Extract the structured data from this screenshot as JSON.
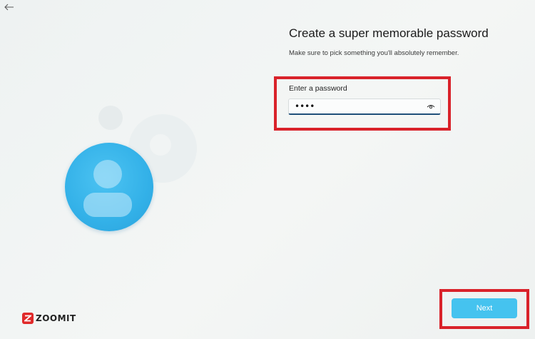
{
  "nav": {
    "back_icon": "arrow-left-icon"
  },
  "page": {
    "title": "Create a super memorable password",
    "subtitle": "Make sure to pick something you'll absolutely remember."
  },
  "password_field": {
    "label": "Enter a password",
    "masked_value": "••••",
    "reveal_icon": "eye-icon"
  },
  "buttons": {
    "next_label": "Next"
  },
  "watermark": {
    "brand": "ZOOMIT"
  },
  "colors": {
    "highlight": "#d9222a",
    "next_button": "#45c3ef",
    "avatar": "#33b1e8",
    "field_underline": "#1f4f79"
  }
}
